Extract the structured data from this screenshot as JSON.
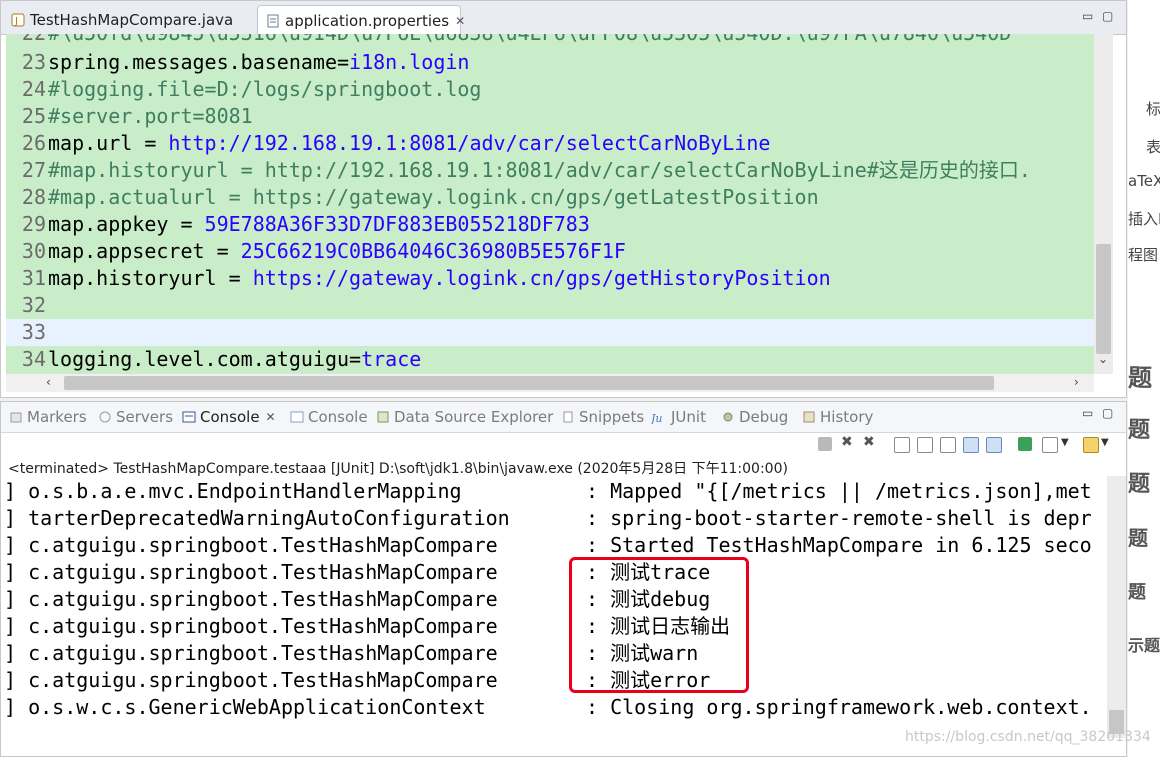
{
  "editor": {
    "tabs": [
      {
        "label": "TestHashMapCompare.java",
        "icon": "java-file-icon",
        "active": false
      },
      {
        "label": "application.properties",
        "icon": "properties-file-icon",
        "active": true,
        "close": "✕"
      }
    ],
    "lines": [
      {
        "num": "22",
        "text": "#\\u50fd\\u9845\\u5316\\u914D\\u7F6E\\u6838\\u4EF6\\uFF08\\u5305\\u540D.\\u97FA\\u7840\\u540D"
      },
      {
        "num": "23",
        "key": "spring.messages.basename=",
        "value": "i18n.login"
      },
      {
        "num": "24",
        "comment": "#logging.file=D:/logs/springboot.log"
      },
      {
        "num": "25",
        "comment": "#server.port=8081"
      },
      {
        "num": "26",
        "key": "map.url = ",
        "value": "http://192.168.19.1:8081/adv/car/selectCarNoByLine"
      },
      {
        "num": "27",
        "comment": "#map.historyurl = http://192.168.19.1:8081/adv/car/selectCarNoByLine#这是历史的接口."
      },
      {
        "num": "28",
        "comment": "#map.actualurl = https://gateway.logink.cn/gps/getLatestPosition"
      },
      {
        "num": "29",
        "key": "map.appkey = ",
        "value": "59E788A36F33D7DF883EB055218DF783"
      },
      {
        "num": "30",
        "key": "map.appsecret = ",
        "value": "25C66219C0BB64046C36980B5E576F1F"
      },
      {
        "num": "31",
        "key": "map.historyurl = ",
        "value": "https://gateway.logink.cn/gps/getHistoryPosition"
      },
      {
        "num": "32",
        "key": "",
        "value": ""
      },
      {
        "num": "33",
        "key": "",
        "value": "",
        "current": true
      },
      {
        "num": "34",
        "key": "logging.level.com.atguigu=",
        "value": "trace"
      }
    ]
  },
  "console": {
    "tabs": [
      {
        "label": "Markers",
        "icon": "markers-icon"
      },
      {
        "label": "Servers",
        "icon": "servers-icon"
      },
      {
        "label": "Console",
        "icon": "console-icon",
        "active": true,
        "close": "✕"
      },
      {
        "label": "Console",
        "icon": "console-icon"
      },
      {
        "label": "Data Source Explorer",
        "icon": "data-source-icon"
      },
      {
        "label": "Snippets",
        "icon": "snippets-icon"
      },
      {
        "label": "JUnit",
        "icon": "junit-icon"
      },
      {
        "label": "Debug",
        "icon": "debug-icon"
      },
      {
        "label": "History",
        "icon": "history-icon"
      }
    ],
    "status": "<terminated> TestHashMapCompare.testaaa [JUnit] D:\\soft\\jdk1.8\\bin\\javaw.exe (2020年5月28日 下午11:00:00)",
    "log": [
      {
        "src": "] o.s.b.a.e.mvc.EndpointHandlerMapping",
        "msg": ": Mapped \"{[/metrics || /metrics.json],met"
      },
      {
        "src": "] tarterDeprecatedWarningAutoConfiguration",
        "msg": ": spring-boot-starter-remote-shell is depr"
      },
      {
        "src": "] c.atguigu.springboot.TestHashMapCompare",
        "msg": ": Started TestHashMapCompare in 6.125 seco"
      },
      {
        "src": "] c.atguigu.springboot.TestHashMapCompare",
        "msg": ": 测试trace"
      },
      {
        "src": "] c.atguigu.springboot.TestHashMapCompare",
        "msg": ": 测试debug"
      },
      {
        "src": "] c.atguigu.springboot.TestHashMapCompare",
        "msg": ": 测试日志输出"
      },
      {
        "src": "] c.atguigu.springboot.TestHashMapCompare",
        "msg": ": 测试warn"
      },
      {
        "src": "] c.atguigu.springboot.TestHashMapCompare",
        "msg": ": 测试error"
      },
      {
        "src": "] o.s.w.c.s.GenericWebApplicationContext",
        "msg": ": Closing org.springframework.web.context."
      }
    ]
  },
  "right_strip": {
    "items": [
      "标",
      "表",
      "aTeX",
      "插入M",
      "程图"
    ],
    "big": [
      "题",
      "题",
      "题",
      "题",
      "题",
      "示题"
    ]
  },
  "watermark": "https://blog.csdn.net/qq_38201334",
  "colors": {
    "editor_bg": "#c8edc8",
    "value": "#2a00ff",
    "comment": "#3f7f5f",
    "highlight": "#e8001c"
  }
}
